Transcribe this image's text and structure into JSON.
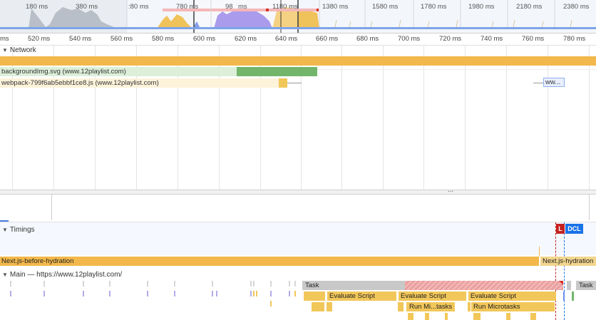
{
  "overview": {
    "tick_labels": [
      "180 ms",
      "380 ms",
      ":80 ms",
      "780 ms",
      "98",
      "ms",
      "1180 ms",
      "1380 ms",
      "1580 ms",
      "1780 ms",
      "1980 ms",
      "2180 ms",
      "2380 ms"
    ]
  },
  "ruler": {
    "labels": [
      "ms",
      "520 ms",
      "540 ms",
      "560 ms",
      "580 ms",
      "600 ms",
      "620 ms",
      "640 ms",
      "660 ms",
      "680 ms",
      "700 ms",
      "720 ms",
      "740 ms",
      "760 ms",
      "780 ms"
    ]
  },
  "network": {
    "title": "Network",
    "requests": [
      {
        "label": "backgroundImg.svg (www.12playlist.com)"
      },
      {
        "label": "webpack-799f6ab5ebbf1ce8.js (www.12playlist.com)"
      },
      {
        "label": "ww..."
      }
    ]
  },
  "resize_handle": "...",
  "timings": {
    "title": "Timings",
    "markers": {
      "load": "L",
      "dcl": "DCL"
    },
    "user_timings": [
      {
        "label": "Next.js-before-hydration"
      },
      {
        "label": "Next.js-hydration"
      }
    ]
  },
  "main": {
    "title": "Main — https://www.12playlist.com/",
    "task_label": "Task",
    "task_label_2": "Task",
    "evaluate_script": [
      "Evaluate Script",
      "Evaluate Script",
      "Evaluate Script"
    ],
    "microtasks": [
      "Run Mi...tasks",
      "Run Microtasks"
    ]
  },
  "colors": {
    "network_gold": "#f2b84b",
    "svg_light": "#dcefd9",
    "svg_dark": "#73b66b",
    "js_light": "#fdf3da",
    "task_gray": "#c8c8c8",
    "long_task_red": "#f2b5b5",
    "script_yellow": "#f2c75a",
    "load_red": "#c5221f",
    "dcl_blue": "#1a73e8"
  }
}
